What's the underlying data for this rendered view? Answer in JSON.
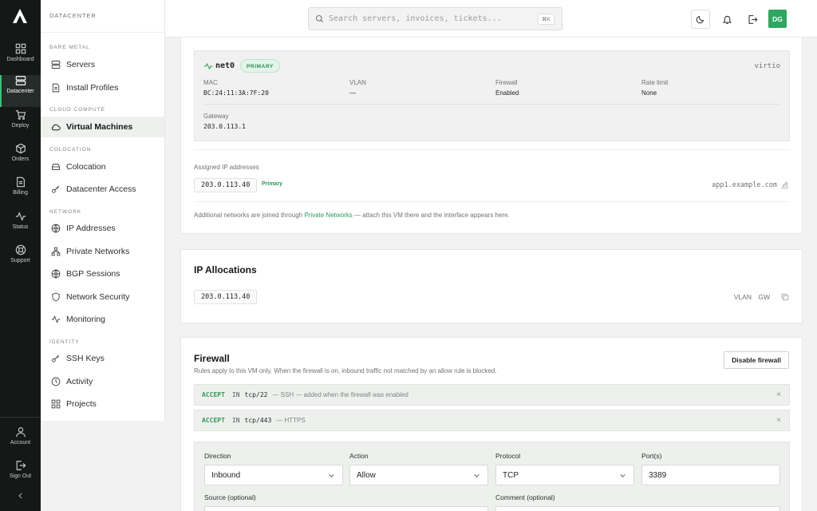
{
  "rail": {
    "items": [
      {
        "label": "Dashboard",
        "icon": "grid-icon"
      },
      {
        "label": "Datacenter",
        "icon": "server-icon"
      },
      {
        "label": "Deploy",
        "icon": "cart-icon"
      },
      {
        "label": "Orders",
        "icon": "box-icon"
      },
      {
        "label": "Billing",
        "icon": "document-icon"
      },
      {
        "label": "Status",
        "icon": "pulse-icon"
      },
      {
        "label": "Support",
        "icon": "lifebuoy-icon"
      }
    ],
    "account_label": "Account",
    "signout_label": "Sign Out",
    "active_color": "#3fbf7a"
  },
  "sidenav": {
    "title": "DATACENTER",
    "sections": {
      "bare_metal": "BARE METAL",
      "cloud_compute": "CLOUD COMPUTE",
      "colocation": "COLOCATION",
      "network": "NETWORK",
      "identity": "IDENTITY"
    },
    "items": {
      "servers": "Servers",
      "install_profiles": "Install Profiles",
      "virtual_machines": "Virtual Machines",
      "colocation": "Colocation",
      "datacenter_access": "Datacenter Access",
      "ip_addresses": "IP Addresses",
      "private_networks": "Private Networks",
      "bgp_sessions": "BGP Sessions",
      "network_security": "Network Security",
      "monitoring": "Monitoring",
      "ssh_keys": "SSH Keys",
      "activity": "Activity",
      "projects": "Projects"
    }
  },
  "topbar": {
    "search_placeholder": "Search servers, invoices, tickets...",
    "search_shortcut": "⌘K",
    "avatar_initials": "DG",
    "avatar_color": "#2fa760"
  },
  "interface": {
    "name": "net0",
    "badge": "PRIMARY",
    "driver": "virtio",
    "fields": {
      "mac_label": "MAC",
      "mac_value": "BC:24:11:3A:7F:20",
      "vlan_label": "VLAN",
      "vlan_value": "—",
      "firewall_label": "Firewall",
      "firewall_value": "Enabled",
      "rate_label": "Rate limit",
      "rate_value": "None",
      "gateway_label": "Gateway",
      "gateway_value": "203.0.113.1"
    },
    "assigned_label": "Assigned IP addresses",
    "assigned_ip": "203.0.113.40",
    "assigned_tag": "Primary",
    "hostname": "app1.example.com",
    "note_before": "Additional networks are joined through ",
    "note_link": "Private Networks",
    "note_after": " — attach this VM there and the interface appears here."
  },
  "allocations": {
    "title": "IP Allocations",
    "ip": "203.0.113.40",
    "vlan_label": "VLAN",
    "gw_label": "GW"
  },
  "firewall": {
    "title": "Firewall",
    "description": "Rules apply to this VM only. When the firewall is on, inbound traffic not matched by an allow rule is blocked.",
    "disable_label": "Disable firewall",
    "rules": [
      {
        "action": "ACCEPT",
        "direction": "IN",
        "port": "tcp/22",
        "comment": "— SSH — added when the firewall was enabled",
        "remove": "×"
      },
      {
        "action": "ACCEPT",
        "direction": "IN",
        "port": "tcp/443",
        "comment": "— HTTPS",
        "remove": "×"
      }
    ],
    "form": {
      "direction_label": "Direction",
      "direction_value": "Inbound",
      "action_label": "Action",
      "action_value": "Allow",
      "protocol_label": "Protocol",
      "protocol_value": "TCP",
      "ports_label": "Port(s)",
      "ports_value": "3389",
      "source_label": "Source (optional)",
      "comment_label": "Comment (optional)"
    }
  }
}
